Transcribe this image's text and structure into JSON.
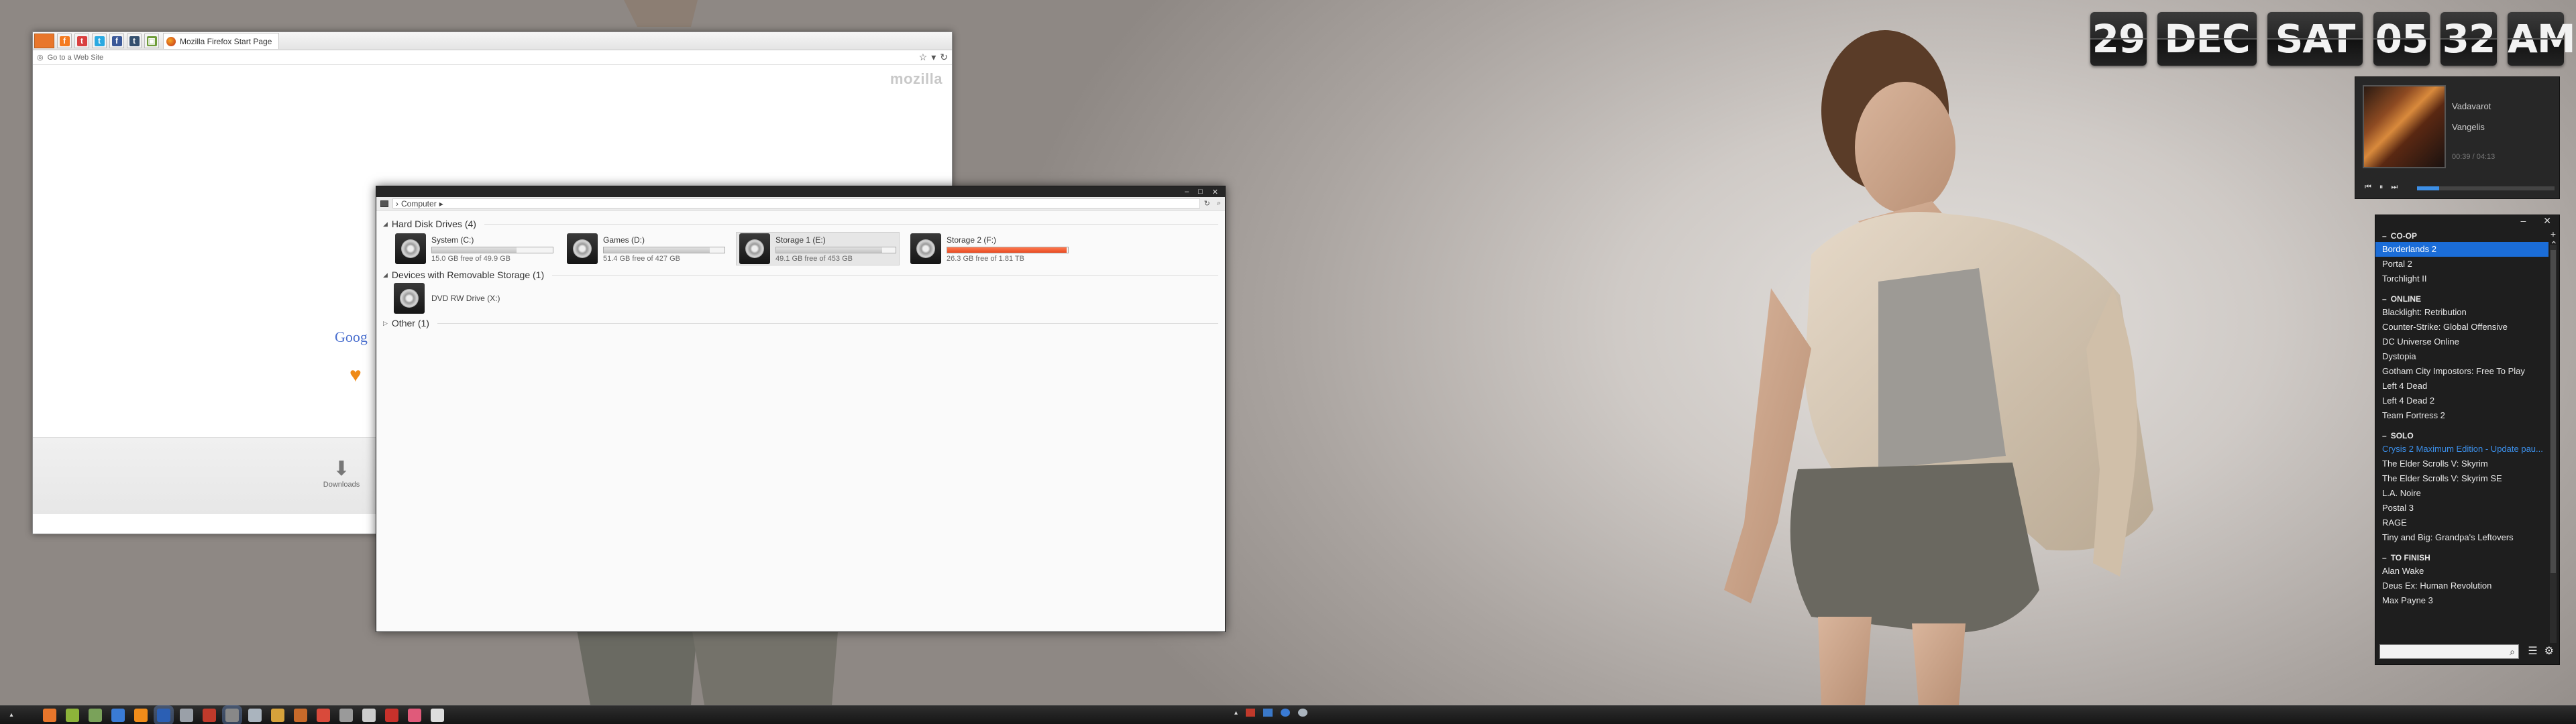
{
  "colors": {
    "accent": "#1b6dd8",
    "storage_warning": "#e84a22",
    "clock_card": "#262626"
  },
  "firefox": {
    "tab_title": "Mozilla Firefox Start Page",
    "url_placeholder": "Go to a Web Site",
    "brand": "mozilla",
    "google_partial": "Goog",
    "downloads_label": "Downloads",
    "pinned_tabs": [
      {
        "icon": "feed-icon",
        "glyph": "f",
        "color": "#f47b20"
      },
      {
        "icon": "tumblr-icon",
        "glyph": "t",
        "color": "#d94040"
      },
      {
        "icon": "twitter-icon",
        "glyph": "t",
        "color": "#29a9e1"
      },
      {
        "icon": "facebook-icon",
        "glyph": "f",
        "color": "#3b5998"
      },
      {
        "icon": "tumblr-alt-icon",
        "glyph": "t",
        "color": "#35506e"
      },
      {
        "icon": "app-icon",
        "glyph": "▣",
        "color": "#6e9c3a"
      }
    ]
  },
  "explorer": {
    "breadcrumb": "Computer",
    "groups": {
      "hdd": "Hard Disk Drives (4)",
      "removable": "Devices with Removable Storage (1)",
      "other": "Other (1)"
    },
    "drives": [
      {
        "name": "System (C:)",
        "free": "15.0 GB free of 49.9 GB",
        "used_fraction": 0.7,
        "warning": false,
        "selected": false
      },
      {
        "name": "Games (D:)",
        "free": "51.4 GB free of 427 GB",
        "used_fraction": 0.88,
        "warning": false,
        "selected": false
      },
      {
        "name": "Storage 1 (E:)",
        "free": "49.1 GB free of 453 GB",
        "used_fraction": 0.89,
        "warning": false,
        "selected": true
      },
      {
        "name": "Storage 2 (F:)",
        "free": "26.3 GB free of 1.81 TB",
        "used_fraction": 0.99,
        "warning": true,
        "selected": false
      }
    ],
    "removable_drive": "DVD RW Drive (X:)"
  },
  "clock": {
    "day": "29",
    "month": "DEC",
    "weekday": "SAT",
    "hour": "05",
    "minute": "32",
    "ampm": "AM"
  },
  "player": {
    "track": "Vadavarot",
    "artist": "Vangelis",
    "time": "00:39 / 04:13",
    "progress": 0.16
  },
  "games": {
    "sections": [
      {
        "title": "CO-OP",
        "items": [
          "Borderlands 2",
          "Portal 2",
          "Torchlight II"
        ]
      },
      {
        "title": "ONLINE",
        "items": [
          "Blacklight: Retribution",
          "Counter-Strike: Global Offensive",
          "DC Universe Online",
          "Dystopia",
          "Gotham City Impostors: Free To Play",
          "Left 4 Dead",
          "Left 4 Dead 2",
          "Team Fortress 2"
        ]
      },
      {
        "title": "SOLO",
        "items": [
          "Crysis 2 Maximum Edition - Update pau...",
          "The Elder Scrolls V: Skyrim",
          "The Elder Scrolls V: Skyrim SE",
          "L.A. Noire",
          "Postal 3",
          "RAGE",
          "Tiny and Big: Grandpa's Leftovers"
        ]
      },
      {
        "title": "TO FINISH",
        "items": [
          "Alan Wake",
          "Deus Ex: Human Revolution",
          "Max Payne 3"
        ]
      }
    ],
    "selected": "Borderlands 2",
    "highlighted": "Crysis 2 Maximum Edition - Update pau..."
  },
  "taskbar": {
    "icons": [
      {
        "name": "firefox-icon",
        "color": "#e8762b"
      },
      {
        "name": "media-icon",
        "color": "#8db33a"
      },
      {
        "name": "photo-icon",
        "color": "#7aa25a"
      },
      {
        "name": "browser-icon",
        "color": "#3a7bd5"
      },
      {
        "name": "vlc-icon",
        "color": "#f08c1a"
      },
      {
        "name": "word-icon",
        "color": "#2b5fb4"
      },
      {
        "name": "window-icon",
        "color": "#9aa0a8"
      },
      {
        "name": "paint-icon",
        "color": "#c03a2b"
      },
      {
        "name": "explorer-icon",
        "color": "#888888"
      },
      {
        "name": "steam-icon",
        "color": "#aab4be"
      },
      {
        "name": "folder-icon",
        "color": "#d6a23b"
      },
      {
        "name": "game-icon",
        "color": "#c86a2a"
      },
      {
        "name": "chrome-icon",
        "color": "#d94a3b"
      },
      {
        "name": "tool-icon",
        "color": "#9a9a9a"
      },
      {
        "name": "glasses-icon",
        "color": "#cccccc"
      },
      {
        "name": "video-icon",
        "color": "#c8312b"
      },
      {
        "name": "cursor-icon",
        "color": "#e05a7a"
      },
      {
        "name": "cap-icon",
        "color": "#dddddd"
      }
    ]
  }
}
